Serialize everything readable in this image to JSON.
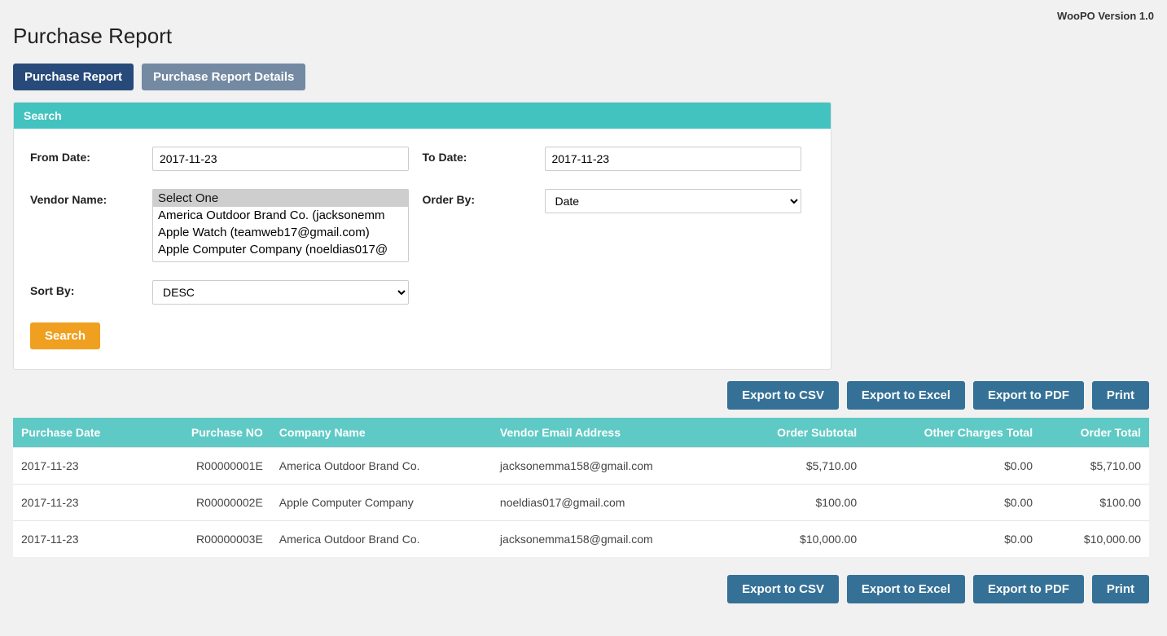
{
  "version_label": "WooPO Version 1.0",
  "page_title": "Purchase Report",
  "tabs": [
    {
      "label": "Purchase Report",
      "active": true
    },
    {
      "label": "Purchase Report Details",
      "active": false
    }
  ],
  "panel": {
    "title": "Search",
    "from_date": {
      "label": "From Date:",
      "value": "2017-11-23"
    },
    "to_date": {
      "label": "To Date:",
      "value": "2017-11-23"
    },
    "vendor": {
      "label": "Vendor Name:",
      "options": [
        "Select One",
        "America Outdoor Brand Co. (jacksonemm",
        "Apple Watch (teamweb17@gmail.com)",
        "Apple Computer Company (noeldias017@"
      ],
      "selected_index": 0
    },
    "order_by": {
      "label": "Order By:",
      "options": [
        "Date"
      ],
      "value": "Date"
    },
    "sort_by": {
      "label": "Sort By:",
      "options": [
        "DESC"
      ],
      "value": "DESC"
    },
    "search_button": "Search"
  },
  "export": {
    "csv": "Export to CSV",
    "excel": "Export to Excel",
    "pdf": "Export to PDF",
    "print": "Print"
  },
  "table": {
    "columns": [
      {
        "label": "Purchase Date",
        "align": "left"
      },
      {
        "label": "Purchase NO",
        "align": "right"
      },
      {
        "label": "Company Name",
        "align": "left"
      },
      {
        "label": "Vendor Email Address",
        "align": "left"
      },
      {
        "label": "Order Subtotal",
        "align": "right"
      },
      {
        "label": "Other Charges Total",
        "align": "right"
      },
      {
        "label": "Order Total",
        "align": "right"
      }
    ],
    "rows": [
      {
        "date": "2017-11-23",
        "no": "R00000001E",
        "company": "America Outdoor Brand Co.",
        "email": "jacksonemma158@gmail.com",
        "subtotal": "$5,710.00",
        "other": "$0.00",
        "total": "$5,710.00"
      },
      {
        "date": "2017-11-23",
        "no": "R00000002E",
        "company": "Apple Computer Company",
        "email": "noeldias017@gmail.com",
        "subtotal": "$100.00",
        "other": "$0.00",
        "total": "$100.00"
      },
      {
        "date": "2017-11-23",
        "no": "R00000003E",
        "company": "America Outdoor Brand Co.",
        "email": "jacksonemma158@gmail.com",
        "subtotal": "$10,000.00",
        "other": "$0.00",
        "total": "$10,000.00"
      }
    ]
  }
}
